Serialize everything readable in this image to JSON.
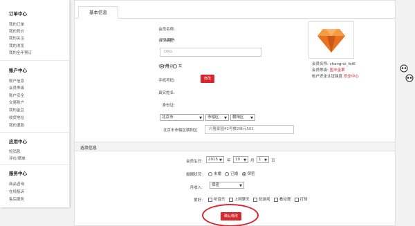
{
  "sidebar": {
    "groups": [
      {
        "title": "订单中心",
        "items": [
          "我的订单",
          "我的竞价",
          "我的关注",
          "我的浏览",
          "我的全年预订"
        ]
      },
      {
        "title": "账户中心",
        "items": [
          "账户信息",
          "会员等级",
          "账户安全",
          "交易账户",
          "我的金豆",
          "收货地址",
          "我的退款"
        ]
      },
      {
        "title": "应用中心",
        "items": [
          "短消息",
          "评价/晒单"
        ]
      },
      {
        "title": "服务中心",
        "items": [
          "商品咨询",
          "在线投诉",
          "售后服务"
        ]
      }
    ]
  },
  "tabs": {
    "basic_info": "基本信息"
  },
  "basic": {
    "member_name_label": "会员名称:",
    "member_type_label": "会员类型:",
    "member_type_value": "个人用户",
    "nickname_label": "昵称:",
    "nickname_value": "DXG",
    "gender_label": "你的性别:",
    "gender_male": "男",
    "gender_female": "女",
    "phone_label": "手机号码:",
    "edit_button": "修改",
    "realname_label": "真实姓名:",
    "idcard_label": "身份证:",
    "location_label": "所在地:",
    "province": "北京市",
    "city": "市辖区",
    "district": "朝阳区",
    "address_prefix": "北京市市辖区朝阳区",
    "address_value": "兴隆家园42号楼2单元501"
  },
  "profile": {
    "name_label": "会员名称:",
    "name_value": "zhangrui_fei6",
    "level_label": "会员等级:",
    "level_value": "国丰金果",
    "security_label": "帐户安全认证强度",
    "security_value": "安全中心"
  },
  "optional": {
    "section_title": "选填信息",
    "birthday_label": "会员生日:",
    "birth_year": "2015",
    "year_unit": "年",
    "birth_month": "10",
    "month_unit": "月",
    "birth_day": "1",
    "day_unit": "日",
    "marital_label": "婚姻状况:",
    "marital_options": [
      "未婚",
      "已婚",
      "保密"
    ],
    "income_label": "月收入:",
    "income_value": "保密",
    "hobby_label": "爱好:",
    "hobbies": [
      "听音乐",
      "上网聊天",
      "玩游戏",
      "看动漫",
      "打球"
    ]
  },
  "confirm_button": "确认修改",
  "colors": {
    "accent": "#d9262e",
    "background": "#f2f2f2"
  },
  "icons": {
    "avatar": "diamond-logo-icon",
    "panda": "panda-icon"
  }
}
